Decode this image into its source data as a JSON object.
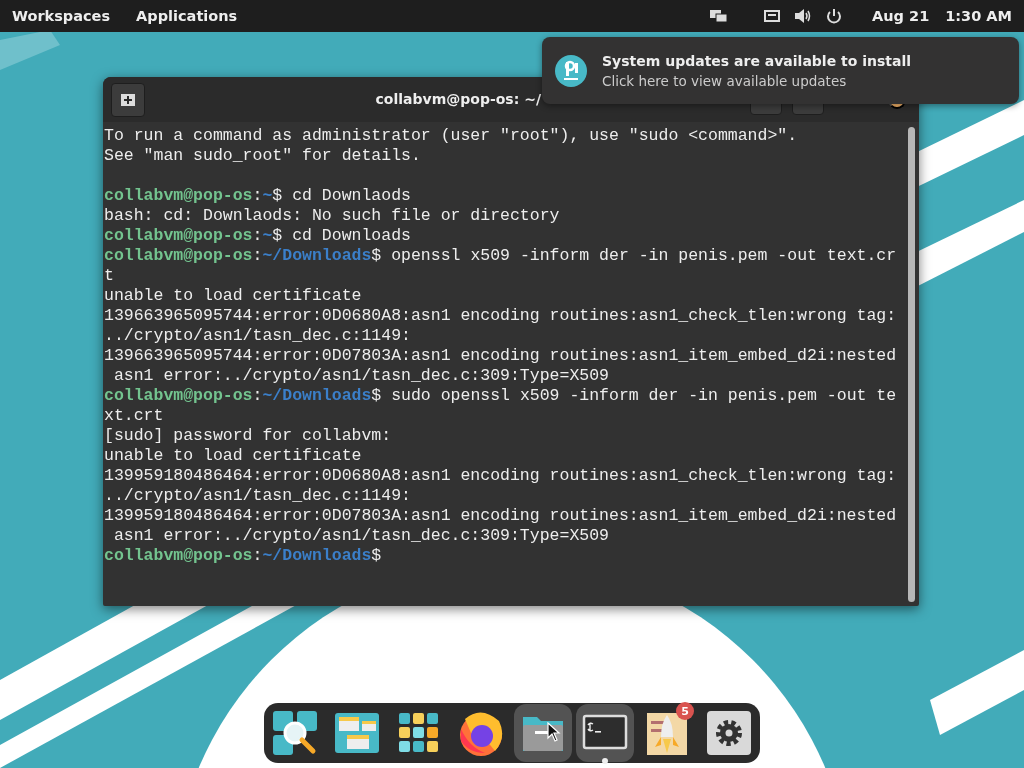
{
  "top_bar": {
    "menus": [
      "Workspaces",
      "Applications"
    ],
    "date": "Aug 21",
    "time": "1:30 AM"
  },
  "notification": {
    "title": "System updates are available to install",
    "body": "Click here to view available updates"
  },
  "terminal": {
    "title": "collabvm@pop-os: ~/",
    "lines": [
      {
        "kind": "output",
        "text": "To run a command as administrator (user \"root\"), use \"sudo <command>\"."
      },
      {
        "kind": "output",
        "text": "See \"man sudo_root\" for details."
      },
      {
        "kind": "blank"
      },
      {
        "kind": "prompt",
        "user": "collabvm@pop-os",
        "sep": ":",
        "path": "~",
        "sigil": "$",
        "command": "cd Downlaods"
      },
      {
        "kind": "output",
        "text": "bash: cd: Downlaods: No such file or directory"
      },
      {
        "kind": "prompt",
        "user": "collabvm@pop-os",
        "sep": ":",
        "path": "~",
        "sigil": "$",
        "command": "cd Downloads"
      },
      {
        "kind": "prompt",
        "user": "collabvm@pop-os",
        "sep": ":",
        "path": "~/Downloads",
        "sigil": "$",
        "command": "openssl x509 -inform der -in penis.pem -out text.cr"
      },
      {
        "kind": "output",
        "text": "t"
      },
      {
        "kind": "output",
        "text": "unable to load certificate"
      },
      {
        "kind": "output",
        "text": "139663965095744:error:0D0680A8:asn1 encoding routines:asn1_check_tlen:wrong tag:"
      },
      {
        "kind": "output",
        "text": "../crypto/asn1/tasn_dec.c:1149:"
      },
      {
        "kind": "output",
        "text": "139663965095744:error:0D07803A:asn1 encoding routines:asn1_item_embed_d2i:nested"
      },
      {
        "kind": "output",
        "text": " asn1 error:../crypto/asn1/tasn_dec.c:309:Type=X509"
      },
      {
        "kind": "prompt",
        "user": "collabvm@pop-os",
        "sep": ":",
        "path": "~/Downloads",
        "sigil": "$",
        "command": "sudo openssl x509 -inform der -in penis.pem -out te"
      },
      {
        "kind": "output",
        "text": "xt.crt"
      },
      {
        "kind": "output",
        "text": "[sudo] password for collabvm:"
      },
      {
        "kind": "output",
        "text": "unable to load certificate"
      },
      {
        "kind": "output",
        "text": "139959180486464:error:0D0680A8:asn1 encoding routines:asn1_check_tlen:wrong tag:"
      },
      {
        "kind": "output",
        "text": "../crypto/asn1/tasn_dec.c:1149:"
      },
      {
        "kind": "output",
        "text": "139959180486464:error:0D07803A:asn1 encoding routines:asn1_item_embed_d2i:nested"
      },
      {
        "kind": "output",
        "text": " asn1 error:../crypto/asn1/tasn_dec.c:309:Type=X509"
      },
      {
        "kind": "prompt",
        "user": "collabvm@pop-os",
        "sep": ":",
        "path": "~/Downloads",
        "sigil": "$"
      }
    ]
  },
  "dock": {
    "items": [
      {
        "kind": "search",
        "highlighted": false,
        "running": false
      },
      {
        "kind": "windows",
        "highlighted": false,
        "running": false
      },
      {
        "kind": "apps",
        "highlighted": false,
        "running": false
      },
      {
        "kind": "browser",
        "highlighted": false,
        "running": false
      },
      {
        "kind": "files",
        "highlighted": true,
        "running": false
      },
      {
        "kind": "terminal",
        "highlighted": true,
        "running": true
      },
      {
        "kind": "store",
        "highlighted": false,
        "running": false,
        "badge": "5"
      },
      {
        "kind": "settings",
        "highlighted": false,
        "running": false
      }
    ]
  }
}
